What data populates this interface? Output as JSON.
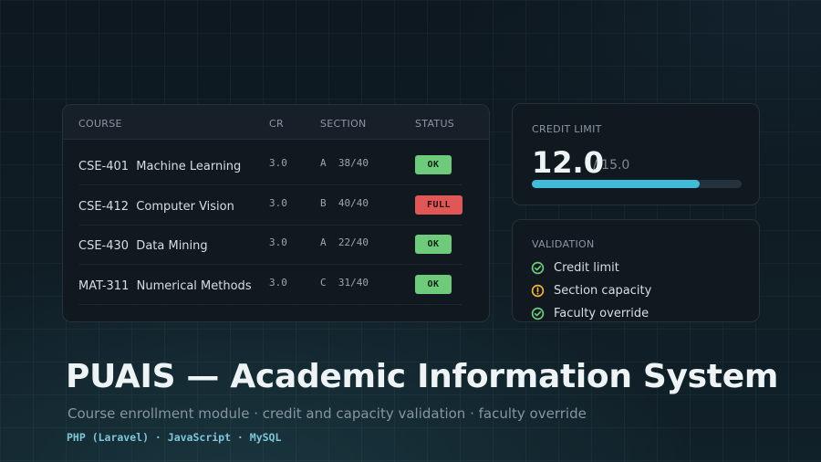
{
  "table": {
    "headers": {
      "course": "COURSE",
      "cr": "CR",
      "section": "SECTION",
      "status": "STATUS"
    },
    "rows": [
      {
        "course": "CSE-401  Machine Learning",
        "cr": "3.0",
        "section": "A  38/40",
        "status": "OK"
      },
      {
        "course": "CSE-412  Computer Vision",
        "cr": "3.0",
        "section": "B  40/40",
        "status": "FULL"
      },
      {
        "course": "CSE-430  Data Mining",
        "cr": "3.0",
        "section": "A  22/40",
        "status": "OK"
      },
      {
        "course": "MAT-311  Numerical Methods",
        "cr": "3.0",
        "section": "C  31/40",
        "status": "OK"
      }
    ]
  },
  "credit": {
    "title": "CREDIT LIMIT",
    "value": "12.0",
    "max": "/ 15.0",
    "progress_fraction": 0.8
  },
  "validation": {
    "title": "VALIDATION",
    "items": [
      {
        "label": "Credit limit",
        "icon": "check-circle-icon"
      },
      {
        "label": "Section capacity",
        "icon": "warning-circle-icon"
      },
      {
        "label": "Faculty override",
        "icon": "check-circle-icon"
      }
    ]
  },
  "hero": {
    "title": "PUAIS — Academic Information System",
    "subtitle": "Course enrollment module  ·  credit and capacity validation  ·  faculty override",
    "tech": "PHP (Laravel) · JavaScript · MySQL"
  },
  "colors": {
    "ok": "#6fcb7c",
    "full": "#e05757",
    "warning": "#f0b43c",
    "accent": "#41bcd8"
  }
}
